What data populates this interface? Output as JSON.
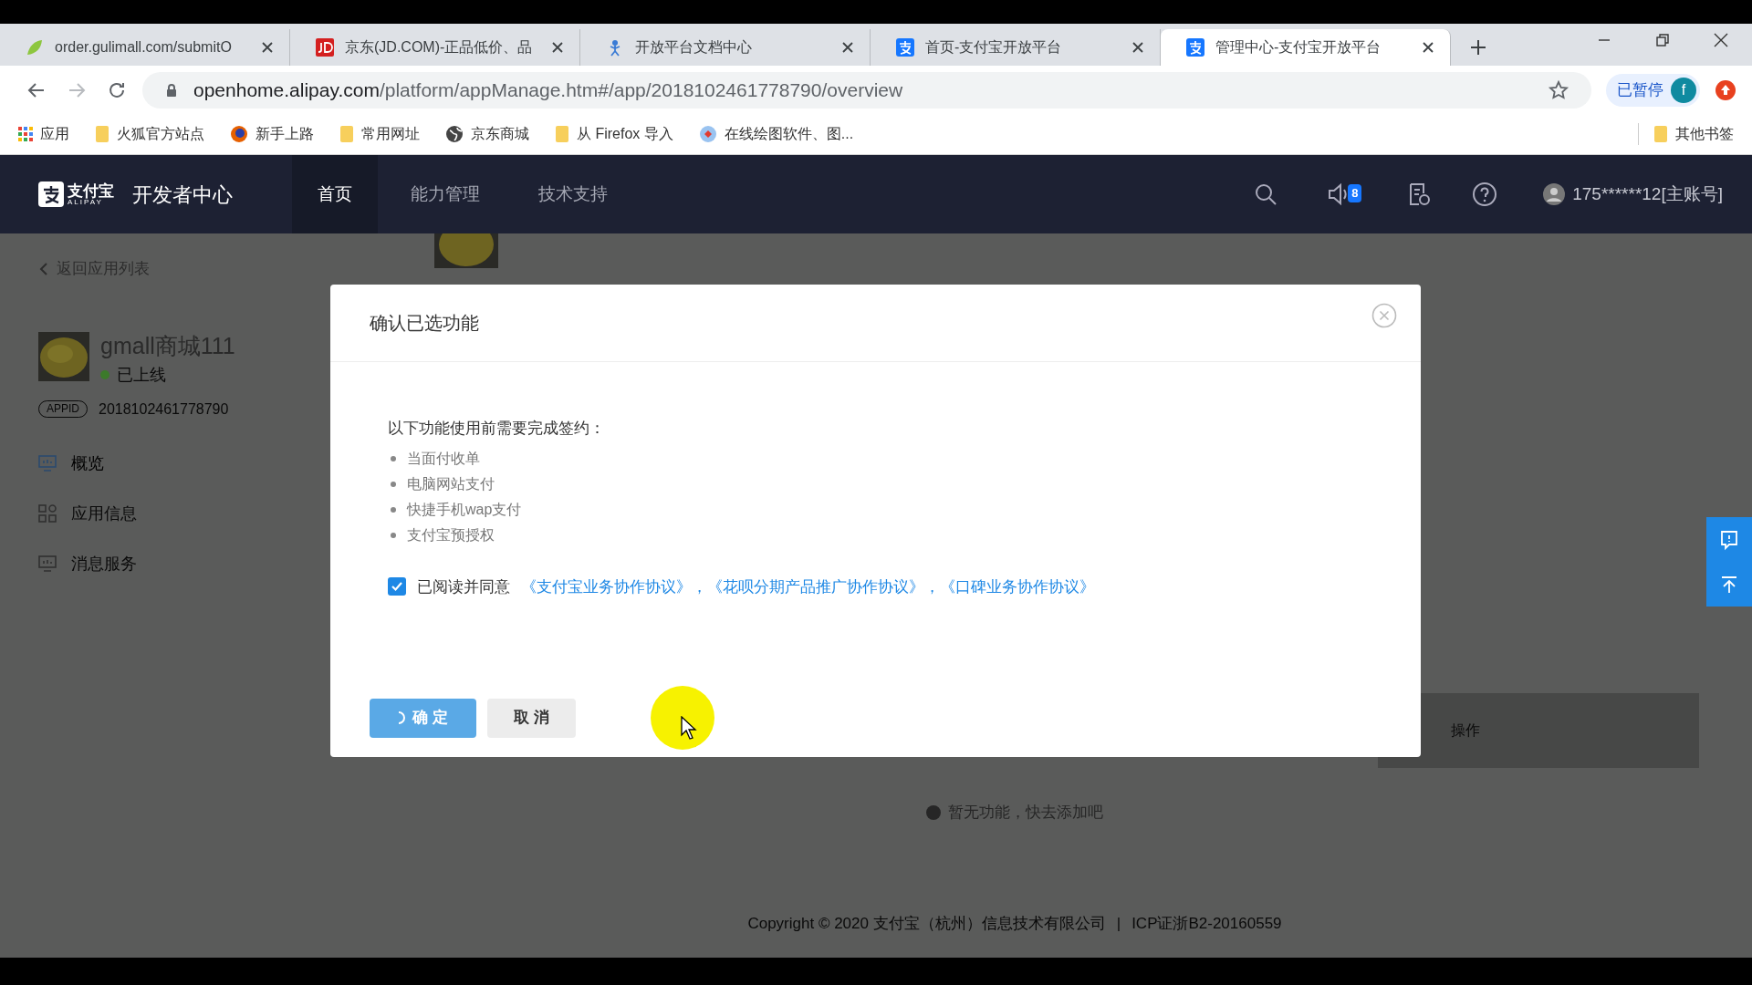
{
  "browser": {
    "tabs": [
      {
        "title": "order.gulimall.com/submitO",
        "kind": "leaf",
        "selected": false
      },
      {
        "title": "京东(JD.COM)-正品低价、品",
        "kind": "jd",
        "selected": false
      },
      {
        "title": "开放平台文档中心",
        "kind": "doc",
        "selected": false
      },
      {
        "title": "首页-支付宝开放平台",
        "kind": "alipay",
        "selected": false
      },
      {
        "title": "管理中心-支付宝开放平台",
        "kind": "alipay",
        "selected": true
      }
    ],
    "url_host": "openhome.alipay.com",
    "url_path": "/platform/appManage.htm#/app/2018102461778790/overview",
    "paused_label": "已暂停",
    "profile_initial": "f",
    "bookmarks": [
      {
        "label": "应用",
        "kind": "apps"
      },
      {
        "label": "火狐官方站点",
        "kind": "folder"
      },
      {
        "label": "新手上路",
        "kind": "firefox"
      },
      {
        "label": "常用网址",
        "kind": "folder"
      },
      {
        "label": "京东商城",
        "kind": "globe"
      },
      {
        "label": "从 Firefox 导入",
        "kind": "folder"
      },
      {
        "label": "在线绘图软件、图...",
        "kind": "web"
      }
    ],
    "other_bookmarks": "其他书签"
  },
  "header": {
    "logo_cn": "支付宝",
    "logo_en": "ALIPAY",
    "title": "开发者中心",
    "nav": [
      {
        "label": "首页",
        "selected": true
      },
      {
        "label": "能力管理",
        "selected": false
      },
      {
        "label": "技术支持",
        "selected": false
      }
    ],
    "notification_count": "8",
    "account": "175******12[主账号]"
  },
  "sidebar": {
    "back": "返回应用列表",
    "app_name": "gmall商城111",
    "status": "已上线",
    "online": true,
    "appid_label": "APPID",
    "appid": "2018102461778790",
    "menu": [
      {
        "label": "概览",
        "kind": "overview",
        "selected": true
      },
      {
        "label": "应用信息",
        "kind": "info",
        "selected": false
      },
      {
        "label": "消息服务",
        "kind": "message",
        "selected": false
      }
    ]
  },
  "content": {
    "table_header": "操作",
    "empty": "暂无功能，快去添加吧"
  },
  "footer": {
    "copyright": "Copyright © 2020 支付宝（杭州）信息技术有限公司",
    "separator": "|",
    "icp": "ICP证浙B2-20160559"
  },
  "modal": {
    "title": "确认已选功能",
    "intro": "以下功能使用前需要完成签约：",
    "features": [
      "当面付收单",
      "电脑网站支付",
      "快捷手机wap支付",
      "支付宝预授权"
    ],
    "agree": {
      "checked": true,
      "label": "已阅读并同意",
      "links": "《支付宝业务协作协议》，《花呗分期产品推广协作协议》，《口碑业务协作协议》"
    },
    "confirm": {
      "label": "确 定",
      "loading": true
    },
    "cancel": "取 消"
  }
}
